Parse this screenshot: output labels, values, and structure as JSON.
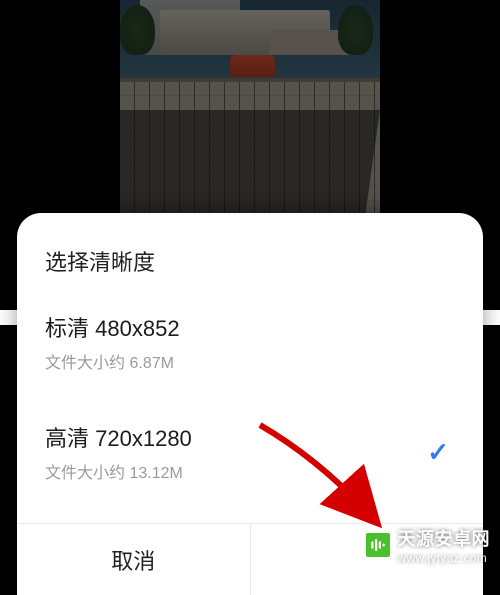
{
  "sheet": {
    "title": "选择清晰度",
    "options": [
      {
        "labelPrefix": "标清",
        "resolution": "480x852",
        "sizePrefix": "文件大小约",
        "size": "6.87M",
        "selected": false
      },
      {
        "labelPrefix": "高清",
        "resolution": "720x1280",
        "sizePrefix": "文件大小约",
        "size": "13.12M",
        "selected": true
      }
    ],
    "cancelLabel": "取消",
    "confirmLabel": ""
  },
  "accentColor": "#2f7bf5",
  "watermark": {
    "title": "天源安卓网",
    "url": "www.jytyaz.com"
  }
}
